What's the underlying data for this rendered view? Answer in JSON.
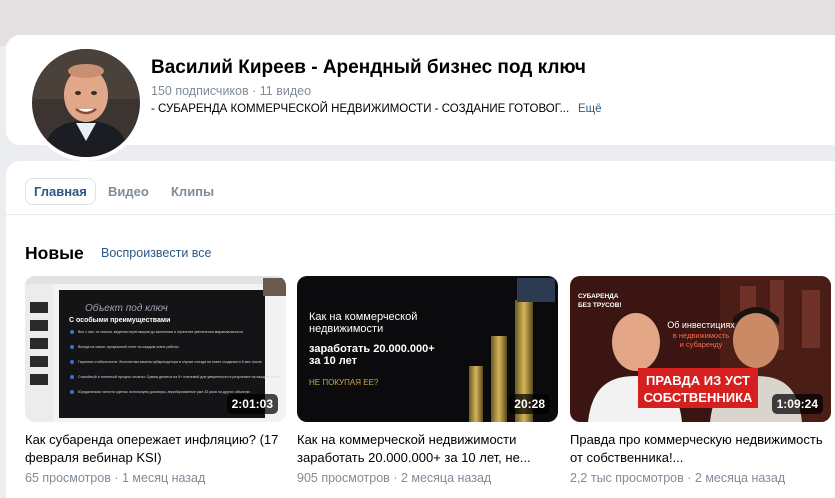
{
  "channel": {
    "title": "Василий Киреев - Арендный бизнес под ключ",
    "subscribers": "150 подписчиков",
    "separator": "·",
    "videos_count": "11 видео",
    "description": "- СУБАРЕНДА КОММЕРЧЕСКОЙ НЕДВИЖИМОСТИ - СОЗДАНИЕ ГОТОВОГ...",
    "more_label": "Ещё"
  },
  "tabs": [
    {
      "label": "Главная",
      "active": true
    },
    {
      "label": "Видео",
      "active": false
    },
    {
      "label": "Клипы",
      "active": false
    }
  ],
  "section": {
    "title": "Новые",
    "play_all": "Воспроизвести все"
  },
  "videos": [
    {
      "title": "Как субаренда опережает инфляцию? (17 февраля вебинар KSI)",
      "views": "65 просмотров",
      "date": "1 месяц назад",
      "duration": "2:01:03",
      "thumb": {
        "heading_line1": "Объект под ключ",
        "heading_line2": "С особыми преимуществами",
        "bullets": [
          "Все с нас: от поиска, ведения переговоров до заселения и стратегии увеличения маржинальности",
          "Всегда на связи: прозрачный отчет на каждом этапе работы",
          "Гарантия стабильности: бесплатная замена субарендатора в случае съезда на этапе создания и 6 мес после",
          "Спокойный и понятный процесс оплаты: Сумма делится на 5+ платежей для уверенности в результате на каждом этапе",
          "Юридическая чистота сделок: используем договоры, апробированные уже 33 раза на других объектах"
        ]
      }
    },
    {
      "title": "Как на коммерческой недвижимости заработать 20.000.000+ за 10 лет, не...",
      "views": "905 просмотров",
      "date": "2 месяца назад",
      "duration": "20:28",
      "thumb": {
        "line1": "Как на коммерческой",
        "line2": "недвижимости",
        "line3": "заработать 20.000.000+",
        "line4": "за 10 лет",
        "line5": "НЕ ПОКУПАЯ ЕЕ?"
      }
    },
    {
      "title": "Правда про коммерческую недвижимость от собственника!...",
      "views": "2,2 тыс просмотров",
      "date": "2 месяца назад",
      "duration": "1:09:24",
      "thumb": {
        "tag1": "СУБАРЕНДА",
        "tag2": "БЕЗ ТРУСОВ!",
        "caption1": "Об инвестициях",
        "caption2": "в недвижимость",
        "caption3": "и субаренду",
        "banner1": "ПРАВДА ИЗ УСТ",
        "banner2": "СОБСТВЕННИКА"
      }
    }
  ],
  "colors": {
    "accent": "#2a5885",
    "muted": "#818c99",
    "page_bg": "#ebedf0",
    "thumb3_banner": "#d6201f"
  }
}
